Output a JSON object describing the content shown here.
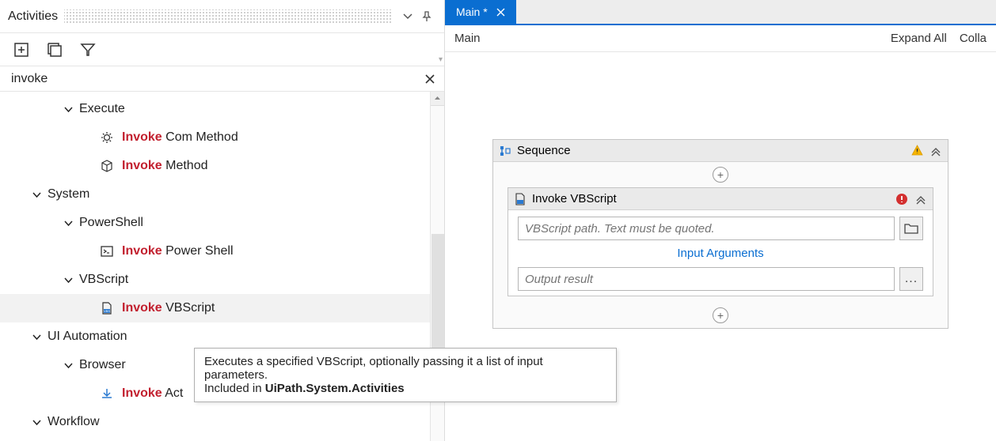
{
  "panel": {
    "title": "Activities",
    "search_value": "invoke"
  },
  "tree": {
    "execute": {
      "label": "Execute"
    },
    "invoke_com": {
      "hl": "Invoke",
      "rest": " Com Method"
    },
    "invoke_method": {
      "hl": "Invoke",
      "rest": " Method"
    },
    "system": {
      "label": "System"
    },
    "powershell_group": {
      "label": "PowerShell"
    },
    "invoke_ps": {
      "hl": "Invoke",
      "rest": " Power Shell"
    },
    "vbscript_group": {
      "label": "VBScript"
    },
    "invoke_vbs": {
      "hl": "Invoke",
      "rest": " VBScript"
    },
    "ui_automation": {
      "label": "UI Automation"
    },
    "browser_group": {
      "label": "Browser"
    },
    "invoke_act": {
      "hl": "Invoke",
      "rest": " Act"
    },
    "workflow": {
      "label": "Workflow"
    }
  },
  "tooltip": {
    "line1": "Executes a specified VBScript, optionally passing it a list of input parameters.",
    "line2_pre": "Included in ",
    "line2_bold": "UiPath.System.Activities"
  },
  "tab": {
    "title": "Main *"
  },
  "crumb": {
    "left": "Main",
    "expand": "Expand All",
    "collapse": "Colla"
  },
  "sequence": {
    "title": "Sequence",
    "inner_title": "Invoke VBScript",
    "path_placeholder": "VBScript path. Text must be quoted.",
    "input_args": "Input Arguments",
    "output_placeholder": "Output result",
    "dots": "..."
  }
}
